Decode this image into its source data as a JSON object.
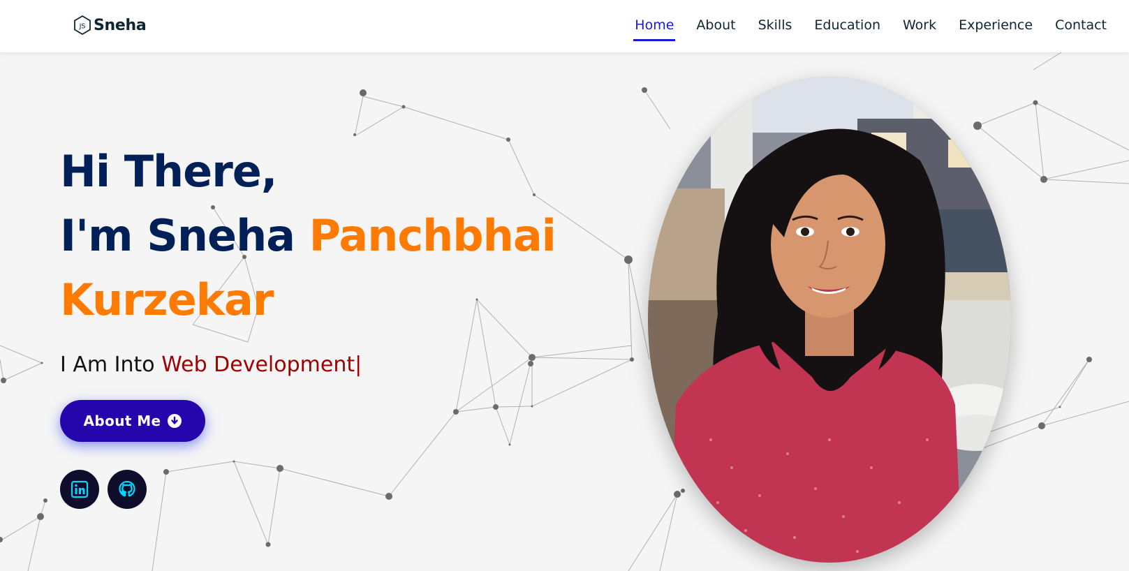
{
  "brand": {
    "name": "Sneha",
    "icon": "js-hexagon-icon"
  },
  "nav": {
    "items": [
      {
        "label": "Home",
        "active": true
      },
      {
        "label": "About"
      },
      {
        "label": "Skills"
      },
      {
        "label": "Education"
      },
      {
        "label": "Work"
      },
      {
        "label": "Experience"
      },
      {
        "label": "Contact"
      }
    ]
  },
  "hero": {
    "greeting": "Hi There,",
    "intro_prefix": "I'm Sneha",
    "name_accent_1": "Panchbhai",
    "name_accent_2": "Kurzekar",
    "into_prefix": "I Am Into",
    "typed_text": "Web Development",
    "caret": "|",
    "button_label": "About Me",
    "button_icon": "arrow-down-circle-icon",
    "socials": [
      {
        "name": "linkedin-icon"
      },
      {
        "name": "github-icon"
      }
    ]
  },
  "colors": {
    "navy": "#002057",
    "orange": "#ff7a00",
    "typed": "#a00000",
    "button": "#2506ad",
    "nav_active": "#1a1ad6",
    "social_icon": "#00d9ff"
  }
}
